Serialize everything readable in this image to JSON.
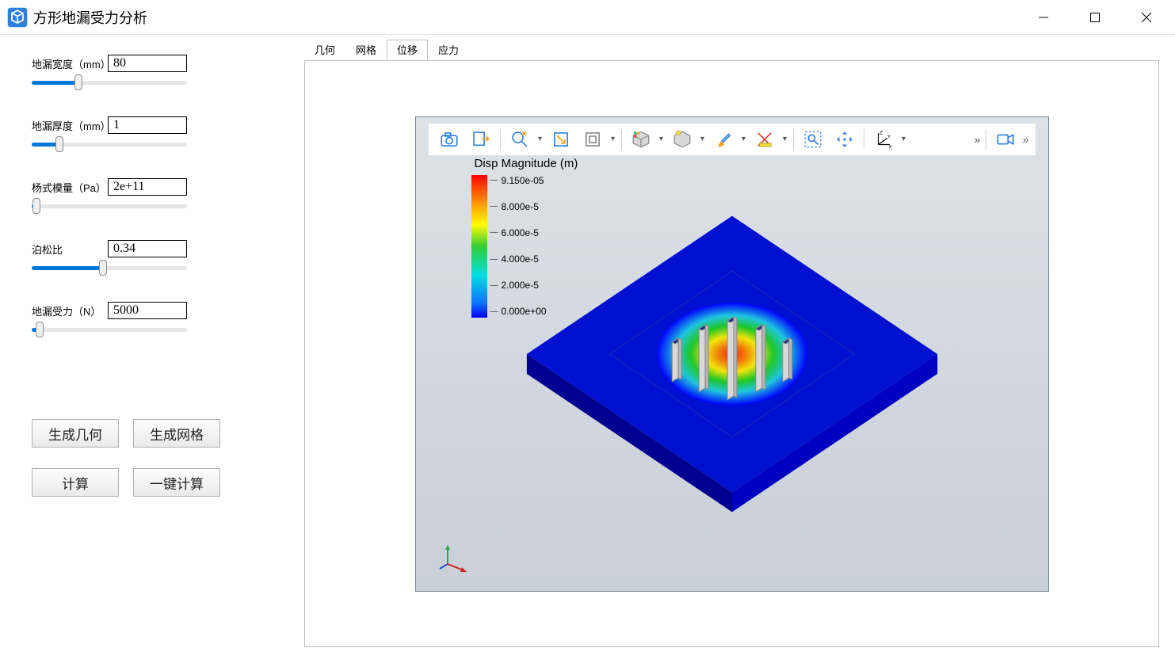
{
  "window": {
    "title": "方形地漏受力分析"
  },
  "sidebar": {
    "params": [
      {
        "label": "地漏宽度（mm）",
        "value": "80",
        "fill_pct": 30
      },
      {
        "label": "地漏厚度（mm）",
        "value": "1",
        "fill_pct": 18
      },
      {
        "label": "杨式模量（Pa）",
        "value": "2e+11",
        "fill_pct": 3
      },
      {
        "label": "泊松比",
        "value": "0.34",
        "fill_pct": 46
      },
      {
        "label": "地漏受力（N）",
        "value": "5000",
        "fill_pct": 5
      }
    ],
    "buttons": {
      "gen_geom": "生成几何",
      "gen_mesh": "生成网格",
      "compute": "计算",
      "one_click": "一键计算"
    }
  },
  "tabs": [
    {
      "label": "几何",
      "active": false
    },
    {
      "label": "网格",
      "active": false
    },
    {
      "label": "位移",
      "active": true
    },
    {
      "label": "应力",
      "active": false
    }
  ],
  "legend": {
    "title": "Disp Magnitude (m)",
    "ticks": [
      "9.150e-05",
      "8.000e-5",
      "6.000e-5",
      "4.000e-5",
      "2.000e-5",
      "0.000e+00"
    ]
  },
  "chart_data": {
    "type": "heatmap",
    "title": "Disp Magnitude (m)",
    "colormap": "jet",
    "range": [
      0.0,
      9.15e-05
    ],
    "ticks": [
      0.0,
      2e-05,
      4e-05,
      6e-05,
      8e-05,
      9.15e-05
    ],
    "description": "Isometric contour plot of displacement magnitude on a square floor-drain plate with five rectangular slots. Peak displacement at the center of the middle slot (~9.15e-5 m) decaying radially to ~0 at the outer edges."
  },
  "icons": {
    "camera": "camera-icon",
    "export": "export-icon",
    "zoom_lightning": "zoom-ext-icon",
    "zoom_fit": "zoom-fit-icon",
    "box_view": "box-view-icon",
    "selectbox": "select-box-icon",
    "light": "light-icon",
    "brush": "brush-icon",
    "ruler": "ruler-icon",
    "marquee": "marquee-icon",
    "pan": "pan-icon",
    "axes": "axes-icon",
    "video": "video-icon"
  }
}
